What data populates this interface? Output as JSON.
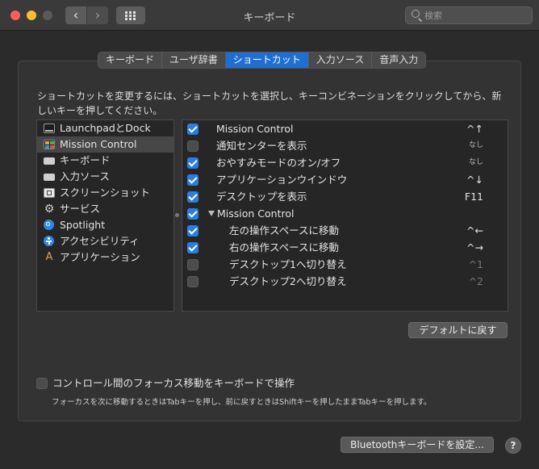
{
  "window": {
    "title": "キーボード"
  },
  "toolbar": {
    "back_label": "‹",
    "forward_label": "›"
  },
  "search": {
    "placeholder": "検索"
  },
  "tabs": [
    {
      "label": "キーボード"
    },
    {
      "label": "ユーザ辞書"
    },
    {
      "label": "ショートカット",
      "active": true
    },
    {
      "label": "入力ソース"
    },
    {
      "label": "音声入力"
    }
  ],
  "description": "ショートカットを変更するには、ショートカットを選択し、キーコンビネーションをクリックしてから、新しいキーを押してください。",
  "categories": [
    {
      "label": "LaunchpadとDock",
      "icon": "launchpad-dock-icon"
    },
    {
      "label": "Mission Control",
      "icon": "mission-control-icon",
      "selected": true
    },
    {
      "label": "キーボード",
      "icon": "keyboard-icon"
    },
    {
      "label": "入力ソース",
      "icon": "input-source-icon"
    },
    {
      "label": "スクリーンショット",
      "icon": "screenshot-icon"
    },
    {
      "label": "サービス",
      "icon": "services-gear-icon"
    },
    {
      "label": "Spotlight",
      "icon": "spotlight-icon"
    },
    {
      "label": "アクセシビリティ",
      "icon": "accessibility-icon"
    },
    {
      "label": "アプリケーション",
      "icon": "applications-icon"
    }
  ],
  "shortcuts": [
    {
      "label": "Mission Control",
      "key": "^↑",
      "checked": true
    },
    {
      "label": "通知センターを表示",
      "key": "なし",
      "checked": false
    },
    {
      "label": "おやすみモードのオン/オフ",
      "key": "なし",
      "checked": true
    },
    {
      "label": "アプリケーションウインドウ",
      "key": "^↓",
      "checked": true
    },
    {
      "label": "デスクトップを表示",
      "key": "F11",
      "checked": true
    },
    {
      "label": "Mission Control",
      "key": "",
      "checked": true,
      "group": true
    },
    {
      "label": "左の操作スペースに移動",
      "key": "^←",
      "checked": true,
      "indent": true
    },
    {
      "label": "右の操作スペースに移動",
      "key": "^→",
      "checked": true,
      "indent": true
    },
    {
      "label": "デスクトップ1へ切り替え",
      "key": "^1",
      "checked": false,
      "indent": true
    },
    {
      "label": "デスクトップ2へ切り替え",
      "key": "^2",
      "checked": false,
      "indent": true
    }
  ],
  "restore_defaults_label": "デフォルトに戻す",
  "focus_option": {
    "label": "コントロール間のフォーカス移動をキーボードで操作",
    "note": "フォーカスを次に移動するときはTabキーを押し、前に戻すときはShiftキーを押したままTabキーを押します。",
    "checked": false
  },
  "bluetooth_button_label": "Bluetoothキーボードを設定...",
  "help_label": "?",
  "colors": {
    "accent": "#1f6ed4",
    "checkbox_on": "#2a7de1",
    "background": "#2b2b2b"
  }
}
